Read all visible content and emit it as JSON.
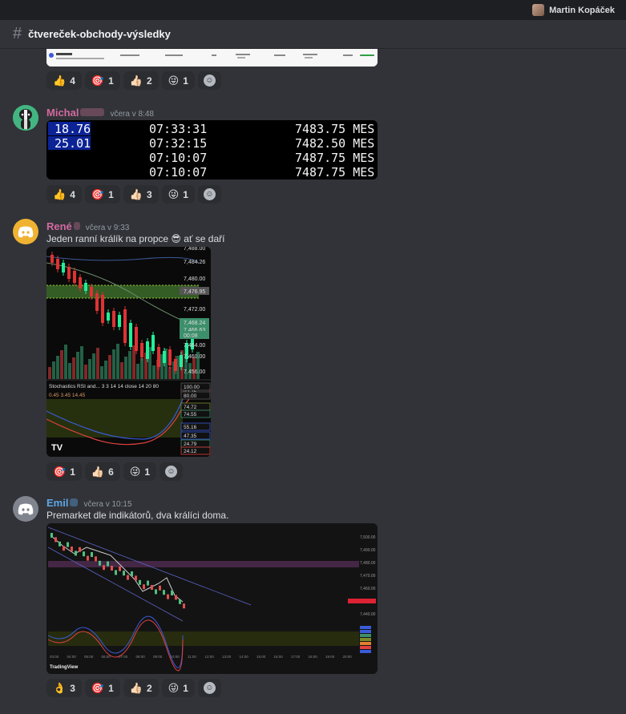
{
  "topbar": {
    "user_name": "Martin Kopáček"
  },
  "channel": {
    "name": "čtvereček-obchody-výsledky"
  },
  "colors": {
    "bg": "#313338",
    "reaction_bg": "#2b2d31",
    "michal": "#d4699f",
    "rene": "#d4699f",
    "emil": "#5ea6e6",
    "highlight_blue": "#0c2396"
  },
  "messages": [
    {
      "reactions": [
        {
          "emoji": "👍",
          "count": "4"
        },
        {
          "emoji": "🎯",
          "count": "1"
        },
        {
          "emoji": "👍🏻",
          "count": "2"
        },
        {
          "emoji": "😜",
          "count": "1"
        }
      ]
    },
    {
      "author": "Michal",
      "timestamp": "včera v 8:48",
      "table_rows": [
        {
          "left": "18.76",
          "time": "07:33:31",
          "price": "7483.75 MES :"
        },
        {
          "left": "25.01",
          "time": "07:32:15",
          "price": "7482.50 MES :"
        },
        {
          "left": "",
          "time": "07:10:07",
          "price": "7487.75 MES :"
        },
        {
          "left": "",
          "time": "07:10:07",
          "price": "7487.75 MES :"
        }
      ],
      "reactions": [
        {
          "emoji": "👍",
          "count": "4"
        },
        {
          "emoji": "🎯",
          "count": "1"
        },
        {
          "emoji": "👍🏻",
          "count": "3"
        },
        {
          "emoji": "😜",
          "count": "1"
        }
      ]
    },
    {
      "author": "René",
      "timestamp": "včera v 9:33",
      "text": "Jeden ranní králík na propce 😎 ať se daří",
      "chart": {
        "price_ticks": [
          "7,488.00",
          "7,484.26",
          "7,480.00",
          "7,476.95",
          "7,472.00",
          "7,468.24",
          "7,466.63",
          "00:08",
          "7,464.00",
          "7,460.00",
          "7,456.00"
        ],
        "indicator_label": "Stochastics RSI and... 3 3 14 14 close 14 20 80",
        "indicator_values": "0.45  3.45  14.45",
        "indicator_ticks": [
          "92.75",
          "100.00",
          "80.00",
          "74.72",
          "74.55",
          "55.16",
          "47.35",
          "24.79",
          "24.12"
        ]
      },
      "reactions": [
        {
          "emoji": "🎯",
          "count": "1"
        },
        {
          "emoji": "👍🏻",
          "count": "6"
        },
        {
          "emoji": "😜",
          "count": "1"
        }
      ]
    },
    {
      "author": "Emil",
      "timestamp": "včera v 10:15",
      "text": "Premarket dle indikátorů, dva králíci doma.",
      "chart": {
        "footer": "TradingView",
        "price_ticks": [
          "7,500.00",
          "7,490.00",
          "7,480.00",
          "7,470.00",
          "7,460.00",
          "7,450.00",
          "7,440.00"
        ],
        "time_ticks": [
          "03:00",
          "04:00",
          "05:00",
          "06:00",
          "07:00",
          "08:00",
          "09:00",
          "10:00",
          "11:00",
          "12:00",
          "13:00",
          "14:00",
          "15:00",
          "16:00",
          "17:00",
          "18:00",
          "19:00",
          "20:00"
        ]
      },
      "reactions": [
        {
          "emoji": "👌",
          "count": "3"
        },
        {
          "emoji": "🎯",
          "count": "1"
        },
        {
          "emoji": "👍🏻",
          "count": "2"
        },
        {
          "emoji": "😜",
          "count": "1"
        }
      ]
    }
  ]
}
